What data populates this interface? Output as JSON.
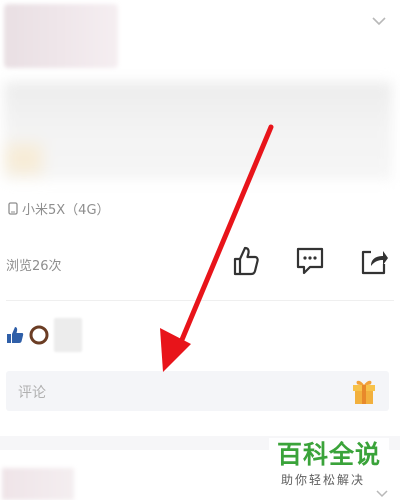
{
  "post": {
    "device": "小米5X（4G）",
    "views": "浏览26次"
  },
  "actions": {
    "like_icon": "thumbs-up-icon",
    "comment_icon": "comment-bubble-icon",
    "share_icon": "share-arrow-icon"
  },
  "comment": {
    "placeholder": "评论",
    "gift_icon": "gift-icon"
  },
  "watermark": {
    "title": "百科全说",
    "subtitle": "助你轻松解决"
  },
  "colors": {
    "annotation_arrow": "#e8141a",
    "watermark_green": "#3aa33a",
    "icon_dark": "#333333"
  }
}
